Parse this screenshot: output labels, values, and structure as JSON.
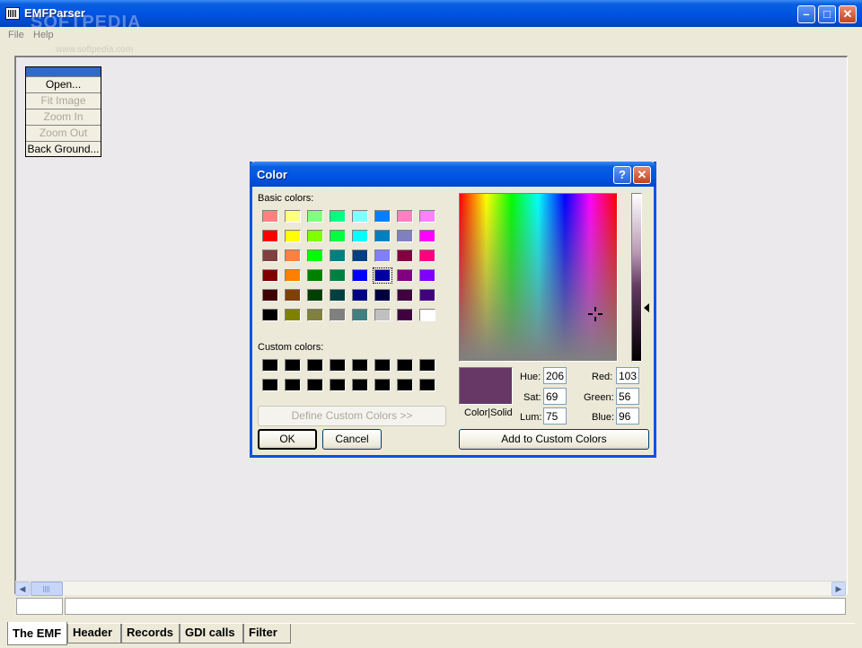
{
  "window": {
    "title": "EMFParser",
    "watermark": "SOFTPEDIA",
    "watermark_url": "www.softpedia.com",
    "controls": {
      "minimize": "–",
      "maximize": "□",
      "close": "✕"
    }
  },
  "menubar": {
    "items": [
      "File",
      "Help"
    ]
  },
  "context_menu": {
    "items": [
      {
        "label": "Open...",
        "enabled": true
      },
      {
        "label": "Fit Image",
        "enabled": false
      },
      {
        "label": "Zoom In",
        "enabled": false
      },
      {
        "label": "Zoom Out",
        "enabled": false
      },
      {
        "label": "Back Ground...",
        "enabled": true
      }
    ]
  },
  "tabs": [
    {
      "label": "The EMF",
      "active": true
    },
    {
      "label": "Header",
      "active": false
    },
    {
      "label": "Records",
      "active": false
    },
    {
      "label": "GDI calls",
      "active": false
    },
    {
      "label": "Filter",
      "active": false
    }
  ],
  "scrollbar": {
    "left_arrow": "◀",
    "right_arrow": "▶"
  },
  "color_dialog": {
    "title": "Color",
    "help_button": "?",
    "close_button": "✕",
    "basic_colors_label": "Basic colors:",
    "basic_colors": [
      [
        "#ff8080",
        "#ffff80",
        "#80ff80",
        "#00ff80",
        "#80ffff",
        "#0080ff",
        "#ff80c0",
        "#ff80ff"
      ],
      [
        "#ff0000",
        "#ffff00",
        "#80ff00",
        "#00ff40",
        "#00ffff",
        "#0080c0",
        "#8080c0",
        "#ff00ff"
      ],
      [
        "#804040",
        "#ff8040",
        "#00ff00",
        "#008080",
        "#004080",
        "#8080ff",
        "#800040",
        "#ff0080"
      ],
      [
        "#800000",
        "#ff8000",
        "#008000",
        "#008040",
        "#0000ff",
        "#0000a0",
        "#800080",
        "#8000ff"
      ],
      [
        "#400000",
        "#804000",
        "#004000",
        "#004040",
        "#000080",
        "#000040",
        "#400040",
        "#400080"
      ],
      [
        "#000000",
        "#808000",
        "#808040",
        "#808080",
        "#408080",
        "#c0c0c0",
        "#400040",
        "#ffffff"
      ]
    ],
    "selected_basic": {
      "row": 3,
      "col": 5
    },
    "custom_colors_label": "Custom colors:",
    "custom_colors": [
      [
        "#000000",
        "#000000",
        "#000000",
        "#000000",
        "#000000",
        "#000000",
        "#000000",
        "#000000"
      ],
      [
        "#000000",
        "#000000",
        "#000000",
        "#000000",
        "#000000",
        "#000000",
        "#000000",
        "#000000"
      ]
    ],
    "define_custom_label": "Define Custom Colors >>",
    "ok_label": "OK",
    "cancel_label": "Cancel",
    "preview_color": "#673866",
    "preview_label": "Color|Solid",
    "hue_label": "Hue:",
    "hue_value": "206",
    "sat_label": "Sat:",
    "sat_value": "69",
    "lum_label": "Lum:",
    "lum_value": "75",
    "red_label": "Red:",
    "red_value": "103",
    "green_label": "Green:",
    "green_value": "56",
    "blue_label": "Blue:",
    "blue_value": "96",
    "add_custom_label": "Add to Custom Colors"
  }
}
